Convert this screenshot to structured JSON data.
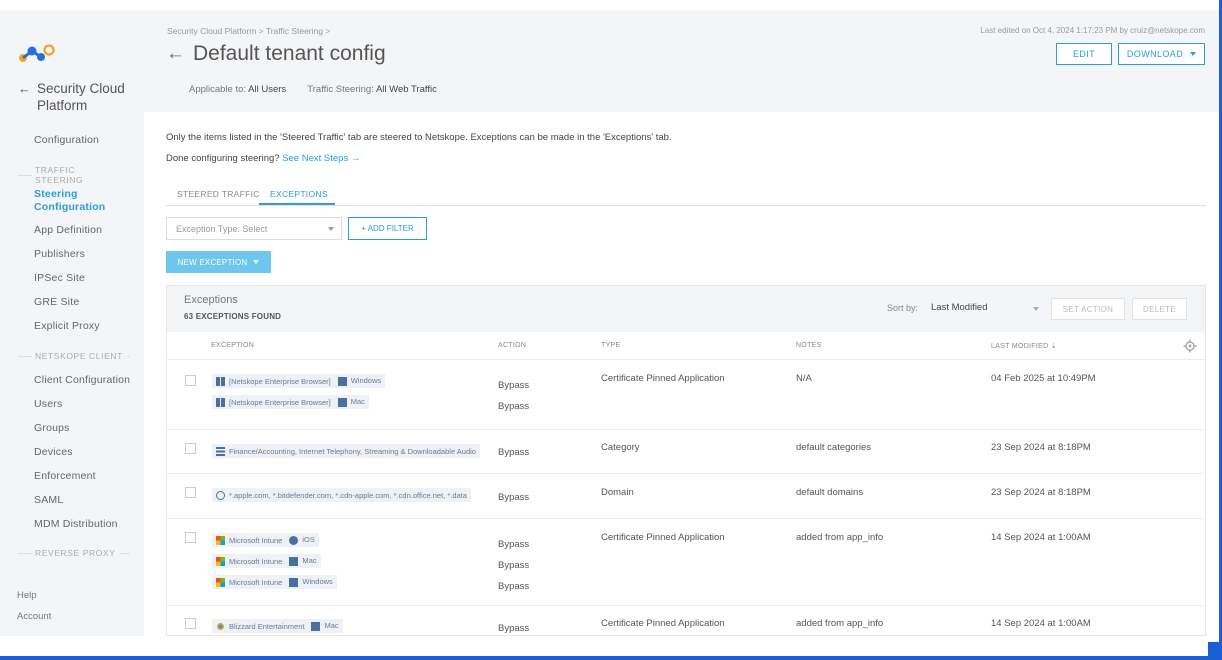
{
  "sidebar": {
    "back_label": "Security Cloud Platform",
    "items": {
      "configuration": "Configuration",
      "section_traffic": "TRAFFIC STEERING",
      "steering_config": "Steering Configuration",
      "app_definition": "App Definition",
      "publishers": "Publishers",
      "ipsec": "IPSec Site",
      "gre": "GRE Site",
      "explicit_proxy": "Explicit Proxy",
      "section_client": "NETSKOPE CLIENT",
      "client_config": "Client Configuration",
      "users": "Users",
      "groups": "Groups",
      "devices": "Devices",
      "enforcement": "Enforcement",
      "saml": "SAML",
      "mdm": "MDM Distribution",
      "section_reverse": "REVERSE PROXY"
    },
    "help": "Help",
    "account": "Account"
  },
  "header": {
    "breadcrumb": "Security Cloud Platform > Traffic Steering >",
    "title": "Default tenant config",
    "applicable_label": "Applicable to:",
    "applicable_value": "All Users",
    "steering_label": "Traffic Steering:",
    "steering_value": "All Web Traffic",
    "last_edited": "Last edited on Oct 4, 2024 1:17:23 PM by cruiz@netskope.com",
    "edit_label": "EDIT",
    "download_label": "DOWNLOAD"
  },
  "main": {
    "info_line": "Only the items listed in the 'Steered Traffic' tab are steered to Netskope. Exceptions can be made in the 'Exceptions' tab.",
    "done_text": "Done configuring steering?",
    "next_steps": "See Next Steps →",
    "tabs": [
      "STEERED TRAFFIC",
      "EXCEPTIONS"
    ],
    "exception_type_placeholder": "Exception Type: Select",
    "add_filter": "+ ADD FILTER",
    "new_exception": "NEW EXCEPTION"
  },
  "table": {
    "title": "Exceptions",
    "count": "63 EXCEPTIONS FOUND",
    "sort_label": "Sort by:",
    "sort_value": "Last Modified",
    "set_action": "SET ACTION",
    "delete": "DELETE",
    "columns": [
      "EXCEPTION",
      "ACTION",
      "TYPE",
      "NOTES",
      "LAST MODIFIED"
    ],
    "sort_arrow": "⇣",
    "rows": [
      {
        "chips": [
          {
            "app": "[Netskope Enterprise Browser]",
            "os": "Windows"
          },
          {
            "app": "[Netskope Enterprise Browser]",
            "os": "Mac"
          }
        ],
        "actions": [
          "Bypass",
          "Bypass"
        ],
        "type": "Certificate Pinned Application",
        "notes": "N/A",
        "modified": "04 Feb 2025 at 10:49PM"
      },
      {
        "chips": [
          {
            "app": "Finance/Accounting, Internet Telephony, Streaming & Downloadable Audio"
          }
        ],
        "actions": [
          "Bypass"
        ],
        "type": "Category",
        "notes": "default categories",
        "modified": "23 Sep 2024 at 8:18PM"
      },
      {
        "chips": [
          {
            "app": "*.apple.com, *.bitdefender.com, *.cdn-apple.com, *.cdn.office.net, *.data"
          }
        ],
        "actions": [
          "Bypass"
        ],
        "type": "Domain",
        "notes": "default domains",
        "modified": "23 Sep 2024 at 8:18PM"
      },
      {
        "chips": [
          {
            "app": "Microsoft Intune",
            "os": "iOS"
          },
          {
            "app": "Microsoft Intune",
            "os": "Mac"
          },
          {
            "app": "Microsoft Intune",
            "os": "Windows"
          }
        ],
        "actions": [
          "Bypass",
          "Bypass",
          "Bypass"
        ],
        "type": "Certificate Pinned Application",
        "notes": "added from app_info",
        "modified": "14 Sep 2024 at 1:00AM"
      },
      {
        "chips": [
          {
            "app": "Blizzard Entertainment",
            "os": "Mac"
          }
        ],
        "actions": [
          "Bypass"
        ],
        "type": "Certificate Pinned Application",
        "notes": "added from app_info",
        "modified": "14 Sep 2024 at 1:00AM"
      }
    ]
  },
  "colors": {
    "accent": "#2a9fd8",
    "primary_button": "#6ec6ec",
    "frame": "#1a5fd6"
  }
}
